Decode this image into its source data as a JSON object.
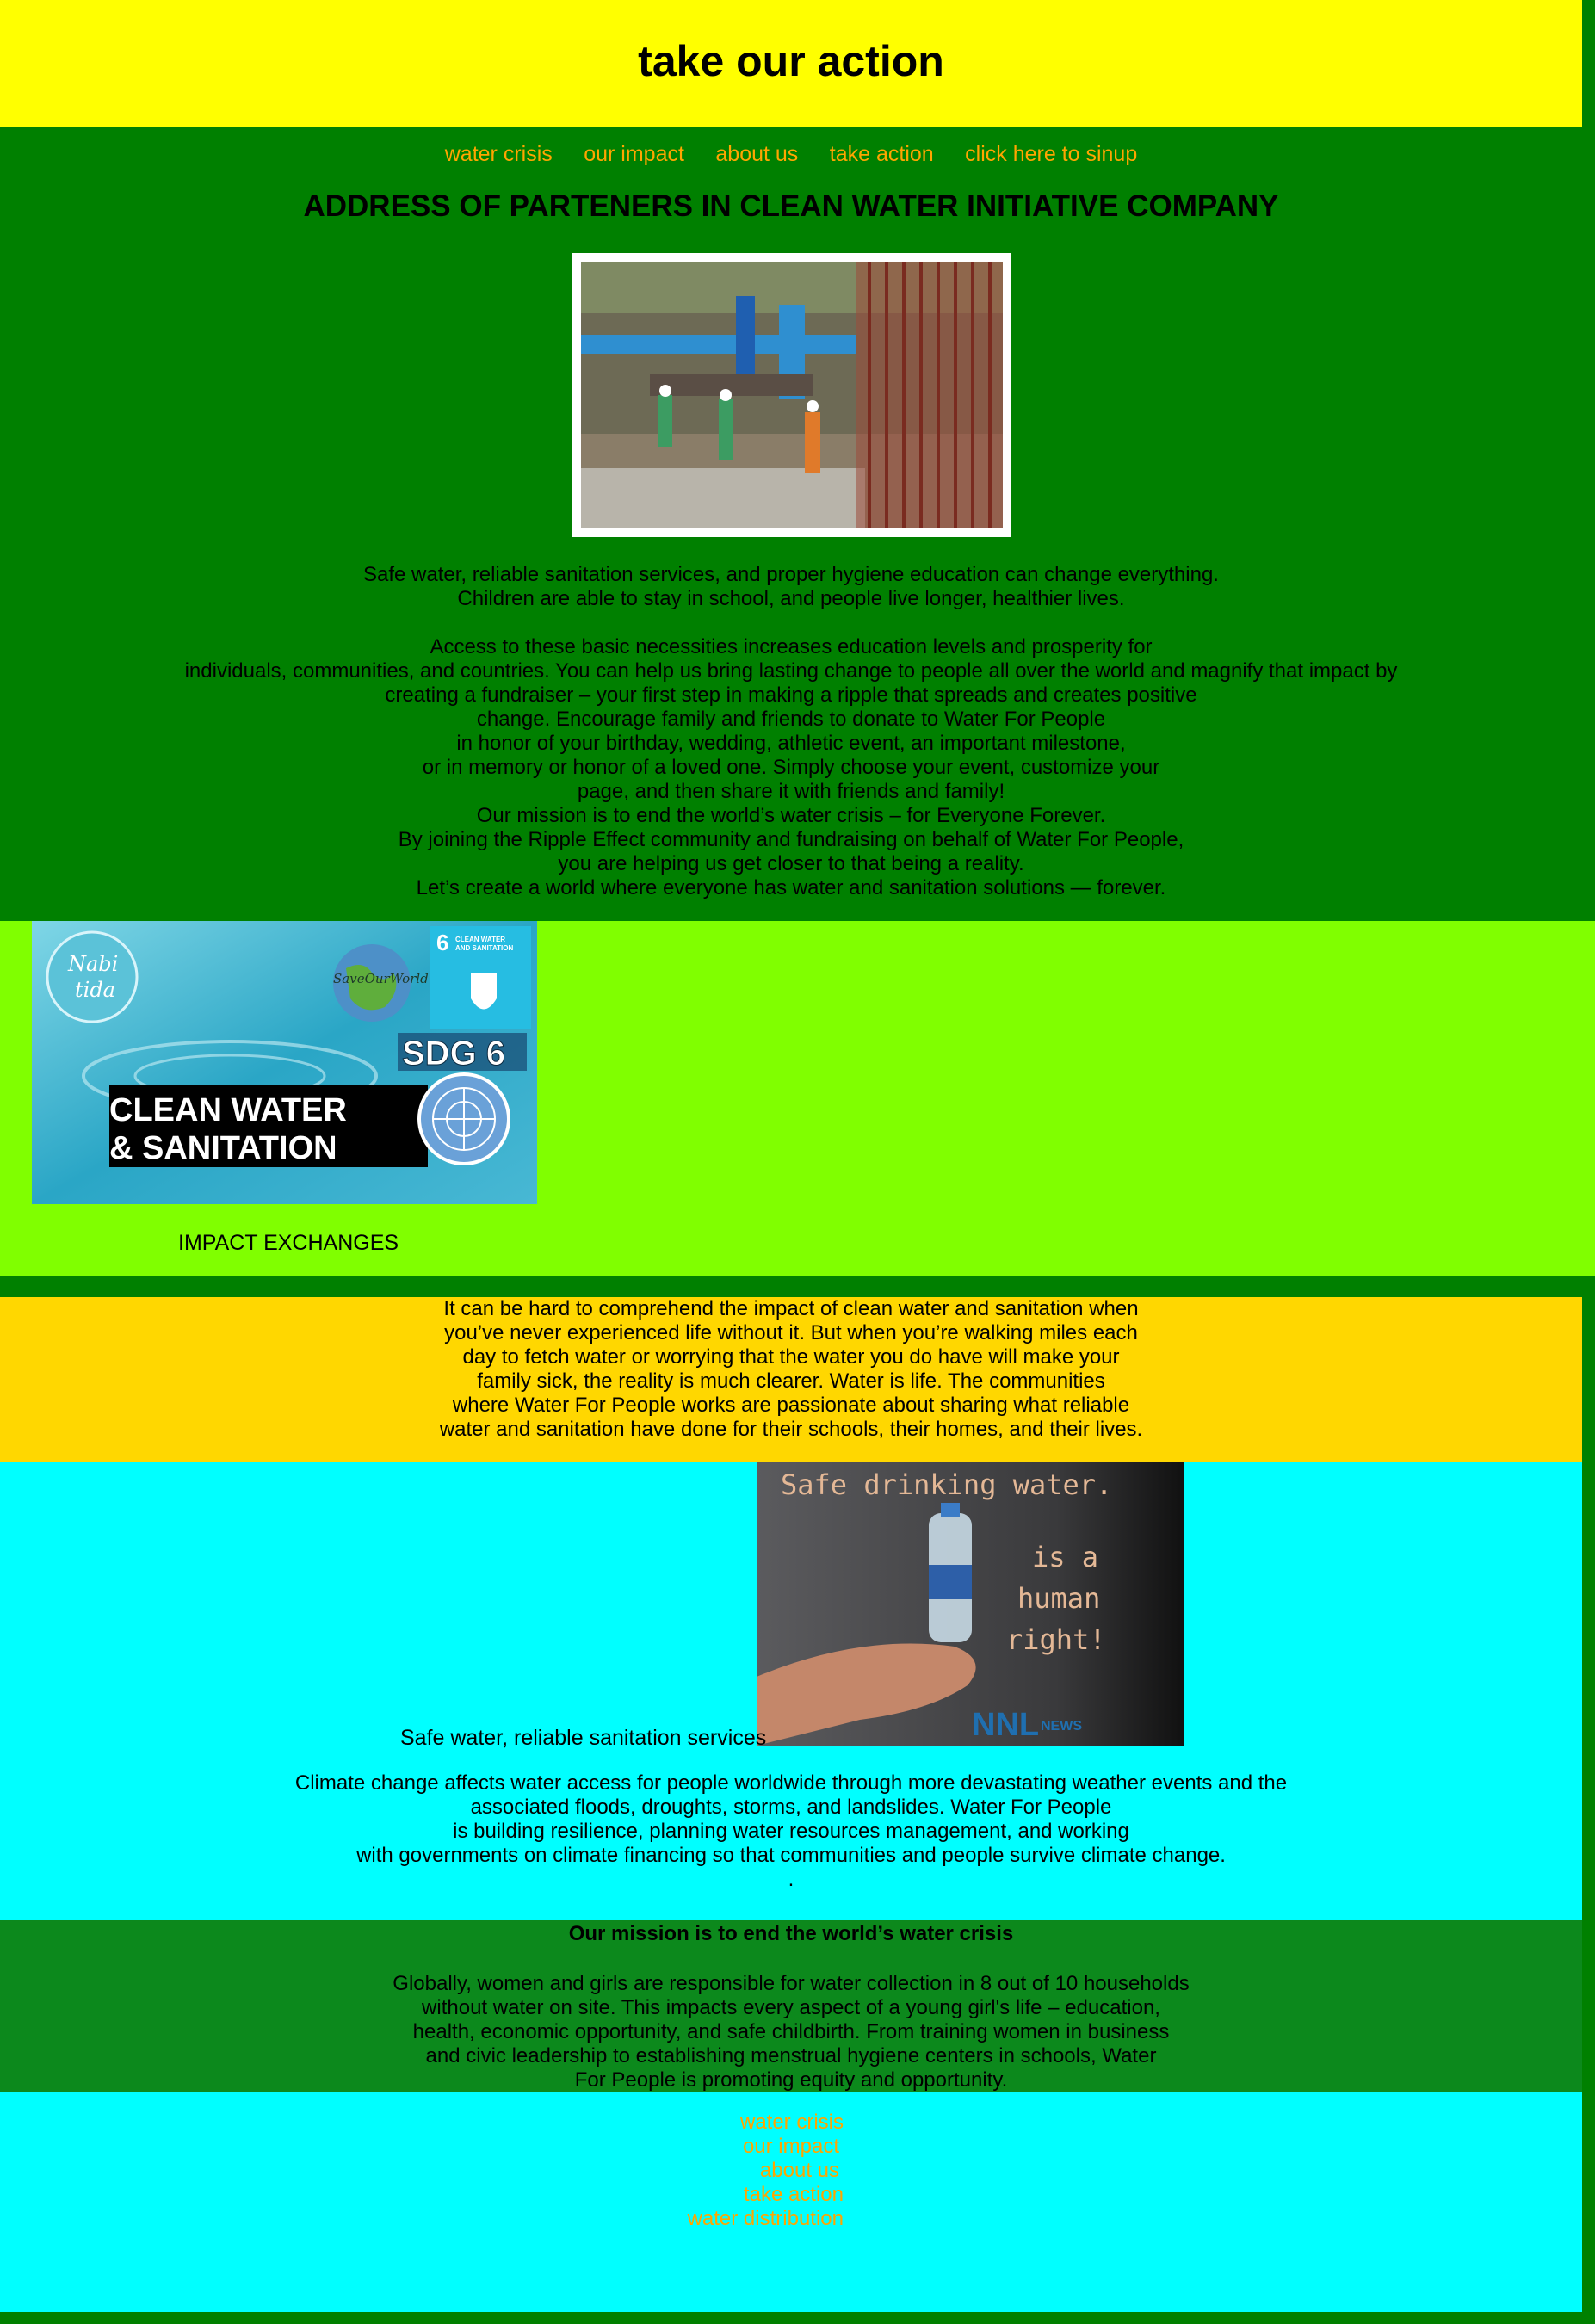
{
  "header": {
    "title": "take our action"
  },
  "nav": {
    "items": [
      "water crisis",
      "our impact",
      "about us",
      "take action",
      "click here to sinup"
    ]
  },
  "main": {
    "heading": "ADDRESS OF PARTENERS IN CLEAN WATER INITIATIVE COMPANY",
    "intro_text": "Safe water, reliable sanitation services, and proper hygiene education can change everything.\nChildren are able to stay in school, and people live longer, healthier lives.\n\nAccess to these basic necessities increases education levels and prosperity for\nindividuals, communities, and countries. You can help us bring lasting change to people all over the world and magnify that impact by\ncreating a fundraiser – your first step in making a ripple that spreads and creates positive\nchange. Encourage family and friends to donate to Water For People\nin honor of your birthday, wedding, athletic event, an important milestone,\nor in memory or honor of a loved one. Simply choose your event, customize your\npage, and then share it with friends and family!\nOur mission is to end the world’s water crisis – for Everyone Forever.\nBy joining the Ripple Effect community and fundraising on behalf of Water For People,\nyou are helping us get closer to that being a reality.\nLet’s create a world where everyone has water and sanitation solutions — forever."
  },
  "sdg_banner": {
    "logo_text": "Nabi\ntida",
    "save_world": "SaveOurWorld",
    "sdg_badge_num": "6",
    "sdg_badge_text": "CLEAN WATER AND SANITATION",
    "sdg_label": "SDG 6",
    "line1": "CLEAN WATER",
    "line2": "& SANITATION",
    "caption": "IMPACT EXCHANGES"
  },
  "impact": {
    "text": "It can be hard to comprehend the impact of clean water and sanitation when\nyou’ve never experienced life without it. But when you’re walking miles each\nday to fetch water or worrying that the water you do have will make your\nfamily sick, the reality is much clearer. Water is life. The communities\nwhere Water For People works are passionate about sharing what reliable\nwater and sanitation have done for their schools, their homes, and their lives."
  },
  "rights": {
    "image_line1": "Safe drinking water.",
    "image_line2": "is a",
    "image_line3": "human",
    "image_line4": "right!",
    "image_brand": "NNL",
    "image_brand2": "NEWS",
    "caption": "Safe water, reliable sanitation services",
    "text": "Climate change affects water access for people worldwide through more devastating weather events and the\nassociated floods, droughts, storms, and landslides. Water For People\nis building resilience, planning water resources management, and working\nwith governments on climate financing so that communities and people survive climate change.\n."
  },
  "mission": {
    "heading": "Our mission is to end the world’s water crisis",
    "text": "Globally, women and girls are responsible for water collection in 8 out of 10 households\nwithout water on site. This impacts every aspect of a young girl's life – education,\nhealth, economic opportunity, and safe childbirth. From training women in business\nand civic leadership to establishing menstrual hygiene centers in schools, Water\nFor People is promoting equity and opportunity."
  },
  "footer": {
    "links": [
      "water crisis",
      "our impact",
      "about us",
      "take action",
      "water distribution"
    ]
  },
  "colors": {
    "header_bg": "#ffff00",
    "page_bg": "#008000",
    "link": "#ffa500",
    "banner_bg": "#80ff00",
    "impact_bg": "#ffd700",
    "cyan_bg": "#00ffff",
    "mission_bg": "#0c891c"
  }
}
